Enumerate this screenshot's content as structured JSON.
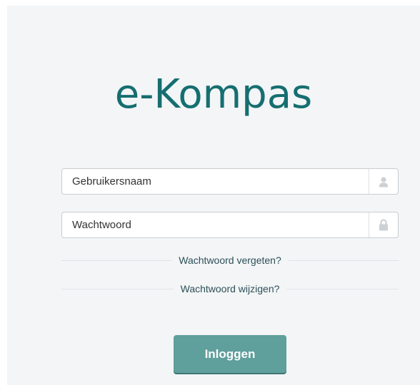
{
  "app": {
    "title": "e-Kompas"
  },
  "login_form": {
    "username": {
      "placeholder": "Gebruikersnaam",
      "value": "",
      "icon": "user-icon"
    },
    "password": {
      "placeholder": "Wachtwoord",
      "value": "",
      "icon": "lock-icon"
    },
    "forgot_password_label": "Wachtwoord vergeten?",
    "change_password_label": "Wachtwoord wijzigen?",
    "submit_label": "Inloggen"
  },
  "colors": {
    "brand": "#166e70",
    "button": "#5f9f9c",
    "panel_background": "#f3f5f7"
  }
}
